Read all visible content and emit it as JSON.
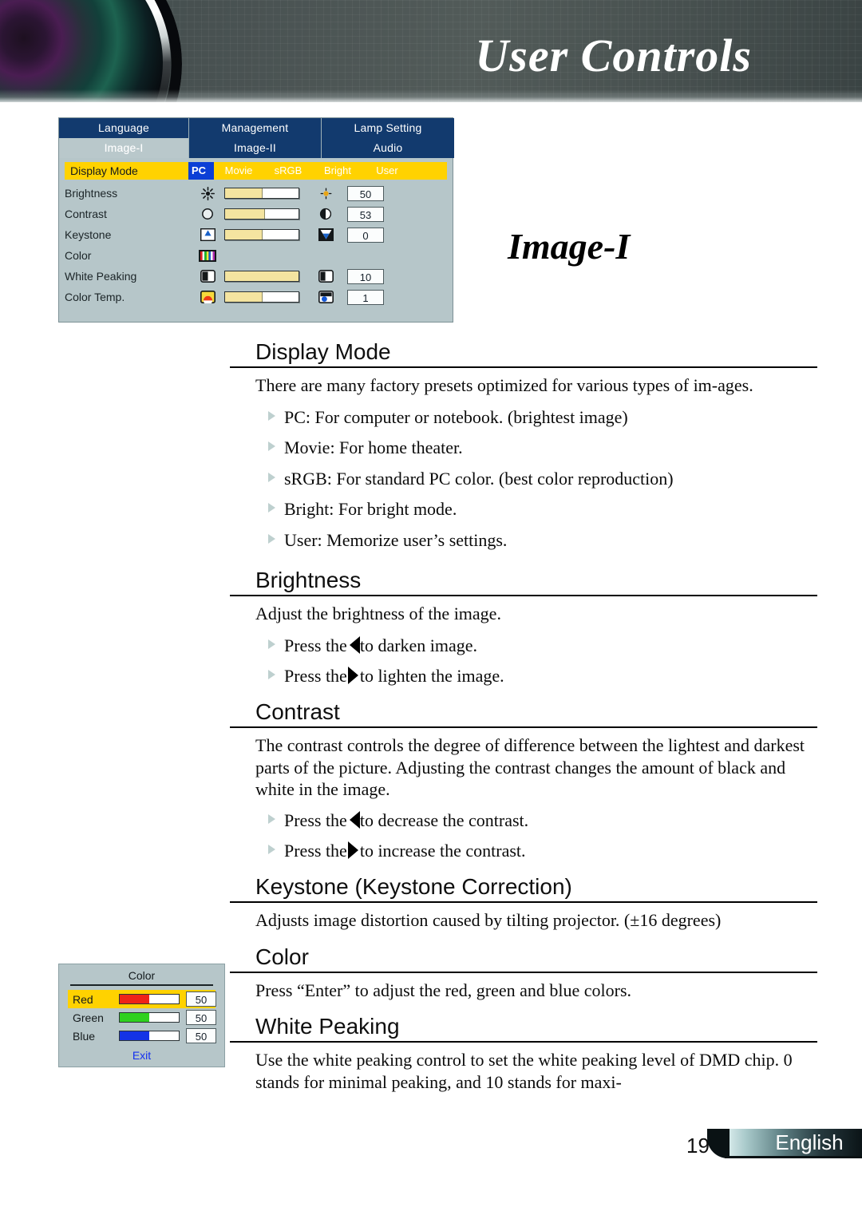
{
  "header": {
    "title": "User Controls",
    "lens_icon": "projector-lens-icon"
  },
  "page_title": "Image-I",
  "osd_menu": {
    "tabs_row1": [
      {
        "label": "Language",
        "active": false
      },
      {
        "label": "Management",
        "active": false
      },
      {
        "label": "Lamp Setting",
        "active": false
      }
    ],
    "tabs_row2": [
      {
        "label": "Image-I",
        "active": true
      },
      {
        "label": "Image-II",
        "active": false
      },
      {
        "label": "Audio",
        "active": false
      }
    ],
    "display_mode": {
      "label": "Display Mode",
      "options": [
        "PC",
        "Movie",
        "sRGB",
        "Bright",
        "User"
      ],
      "selected": "PC"
    },
    "rows": [
      {
        "label": "Brightness",
        "left_icon": "sun-burst-icon",
        "right_icon": "sun-small-icon",
        "fill_pct": 50,
        "value": "50"
      },
      {
        "label": "Contrast",
        "left_icon": "circle-icon",
        "right_icon": "half-circle-icon",
        "fill_pct": 53,
        "value": "53"
      },
      {
        "label": "Keystone",
        "left_icon": "keystone-up-icon",
        "right_icon": "keystone-down-icon",
        "fill_pct": 50,
        "value": "0"
      },
      {
        "label": "Color",
        "left_icon": "rgb-bars-icon",
        "right_icon": "",
        "fill_pct": null,
        "value": ""
      },
      {
        "label": "White Peaking",
        "left_icon": "white-peak-icon",
        "right_icon": "white-peak-2-icon",
        "fill_pct": 100,
        "value": "10"
      },
      {
        "label": "Color Temp.",
        "left_icon": "color-temp-warm-icon",
        "right_icon": "color-temp-cool-icon",
        "fill_pct": 50,
        "value": "1"
      }
    ],
    "colors": {
      "tab_bg": "#123a6e",
      "panel_bg": "#b6c6c9",
      "highlight": "#ffd200",
      "selected_option": "#0b3fd6",
      "slider_fill": "#f4e4a0"
    }
  },
  "sections": [
    {
      "heading": "Display Mode",
      "paragraphs": [
        "There are many factory presets optimized for various types of im-ages."
      ],
      "bullets": [
        "PC: For computer or notebook. (brightest image)",
        "Movie: For home theater.",
        "sRGB: For standard PC color. (best color reproduction)",
        "Bright: For bright mode.",
        "User: Memorize user’s settings."
      ]
    },
    {
      "heading": "Brightness",
      "paragraphs": [
        "Adjust the brightness of the image."
      ],
      "bullets_arrow": [
        {
          "pre": "Press the",
          "arrow": "left",
          "post": "to darken image."
        },
        {
          "pre": "Press the",
          "arrow": "right",
          "post": "to lighten the image."
        }
      ]
    },
    {
      "heading": "Contrast",
      "paragraphs": [
        "The contrast controls the degree of difference between the lightest and darkest parts of the picture. Adjusting the contrast changes the amount of black and white in the image."
      ],
      "bullets_arrow": [
        {
          "pre": "Press the",
          "arrow": "left",
          "post": "to decrease the contrast."
        },
        {
          "pre": "Press the",
          "arrow": "right",
          "post": "to increase the contrast."
        }
      ]
    },
    {
      "heading": "Keystone (Keystone Correction)",
      "paragraphs": [
        "Adjusts image distortion caused by tilting projector. (±16 degrees)"
      ]
    },
    {
      "heading": "Color",
      "paragraphs": [
        "Press “Enter” to adjust the red, green and blue colors."
      ]
    },
    {
      "heading": "White Peaking",
      "paragraphs": [
        "Use the white peaking control to set the white peaking level of DMD chip. 0 stands for minimal peaking, and 10 stands for maxi-"
      ]
    }
  ],
  "color_submenu": {
    "title": "Color",
    "rows": [
      {
        "label": "Red",
        "value": "50",
        "fill_pct": 50,
        "bar_color": "#ee2418",
        "highlighted": true
      },
      {
        "label": "Green",
        "value": "50",
        "fill_pct": 50,
        "bar_color": "#2fd11f",
        "highlighted": false
      },
      {
        "label": "Blue",
        "value": "50",
        "fill_pct": 50,
        "bar_color": "#1433e6",
        "highlighted": false
      }
    ],
    "exit_label": "Exit"
  },
  "footer": {
    "page_number": "19",
    "language": "English"
  }
}
